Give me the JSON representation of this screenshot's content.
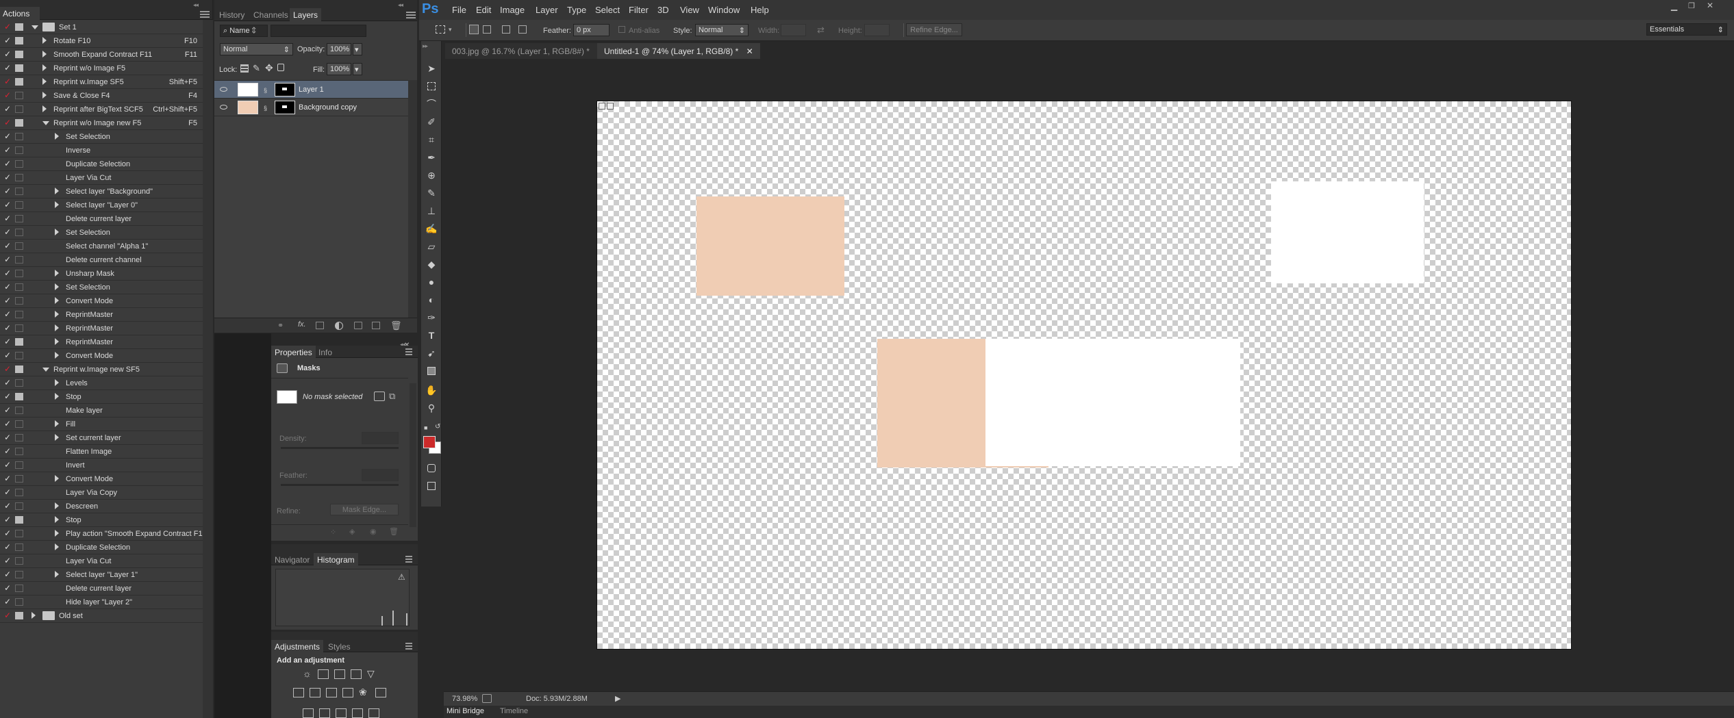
{
  "app": {
    "logo": "Ps"
  },
  "menu": [
    "File",
    "Edit",
    "Image",
    "Layer",
    "Type",
    "Select",
    "Filter",
    "3D",
    "View",
    "Window",
    "Help"
  ],
  "workspace": "Essentials",
  "options": {
    "feather_label": "Feather:",
    "feather_value": "0 px",
    "antialias_label": "Anti-alias",
    "style_label": "Style:",
    "style_value": "Normal",
    "width_label": "Width:",
    "height_label": "Height:",
    "refine_button": "Refine Edge..."
  },
  "doc_tabs": [
    {
      "label": "003.jpg @ 16.7% (Layer 1, RGB/8#) *",
      "selected": false
    },
    {
      "label": "Untitled-1 @ 74% (Layer 1, RGB/8) *",
      "selected": true
    }
  ],
  "actions": {
    "tab": "Actions",
    "rows": [
      {
        "label": "Set 1",
        "key": "",
        "check": true,
        "red": true,
        "dialog": "on",
        "level": 0,
        "kind": "folder",
        "open": true
      },
      {
        "label": "Rotate F10",
        "key": "F10",
        "check": true,
        "red": false,
        "dialog": "on",
        "level": 1,
        "kind": "action",
        "open": false
      },
      {
        "label": "Smooth Expand Contract F11",
        "key": "F11",
        "check": true,
        "red": false,
        "dialog": "on",
        "level": 1,
        "kind": "action",
        "open": false
      },
      {
        "label": "Reprint w/o Image F5",
        "key": "",
        "check": true,
        "red": false,
        "dialog": "on",
        "level": 1,
        "kind": "action",
        "open": false
      },
      {
        "label": "Reprint w.Image SF5",
        "key": "Shift+F5",
        "check": true,
        "red": true,
        "dialog": "on",
        "level": 1,
        "kind": "action",
        "open": false
      },
      {
        "label": "Save & Close F4",
        "key": "F4",
        "check": true,
        "red": true,
        "dialog": "off",
        "level": 1,
        "kind": "action",
        "open": false
      },
      {
        "label": "Reprint after BigText SCF5",
        "key": "Ctrl+Shift+F5",
        "check": true,
        "red": false,
        "dialog": "off",
        "level": 1,
        "kind": "action",
        "open": false
      },
      {
        "label": "Reprint w/o Image new F5",
        "key": "F5",
        "check": true,
        "red": true,
        "dialog": "on",
        "level": 1,
        "kind": "action",
        "open": true
      },
      {
        "label": "Set Selection",
        "key": "",
        "check": true,
        "red": false,
        "dialog": "off",
        "level": 2,
        "kind": "step",
        "open": false
      },
      {
        "label": "Inverse",
        "key": "",
        "check": true,
        "red": false,
        "dialog": "off",
        "level": 2,
        "kind": "leaf",
        "open": false
      },
      {
        "label": "Duplicate Selection",
        "key": "",
        "check": true,
        "red": false,
        "dialog": "off",
        "level": 2,
        "kind": "leaf",
        "open": false
      },
      {
        "label": "Layer Via Cut",
        "key": "",
        "check": true,
        "red": false,
        "dialog": "off",
        "level": 2,
        "kind": "leaf",
        "open": false
      },
      {
        "label": "Select layer \"Background\"",
        "key": "",
        "check": true,
        "red": false,
        "dialog": "off",
        "level": 2,
        "kind": "step",
        "open": false
      },
      {
        "label": "Select layer \"Layer 0\"",
        "key": "",
        "check": true,
        "red": false,
        "dialog": "off",
        "level": 2,
        "kind": "step",
        "open": false
      },
      {
        "label": "Delete current layer",
        "key": "",
        "check": true,
        "red": false,
        "dialog": "off",
        "level": 2,
        "kind": "leaf",
        "open": false
      },
      {
        "label": "Set Selection",
        "key": "",
        "check": true,
        "red": false,
        "dialog": "off",
        "level": 2,
        "kind": "step",
        "open": false
      },
      {
        "label": "Select channel \"Alpha 1\"",
        "key": "",
        "check": true,
        "red": false,
        "dialog": "off",
        "level": 2,
        "kind": "leaf",
        "open": false
      },
      {
        "label": "Delete current channel",
        "key": "",
        "check": true,
        "red": false,
        "dialog": "off",
        "level": 2,
        "kind": "leaf",
        "open": false
      },
      {
        "label": "Unsharp Mask",
        "key": "",
        "check": true,
        "red": false,
        "dialog": "off",
        "level": 2,
        "kind": "step",
        "open": false
      },
      {
        "label": "Set Selection",
        "key": "",
        "check": true,
        "red": false,
        "dialog": "off",
        "level": 2,
        "kind": "step",
        "open": false
      },
      {
        "label": "Convert Mode",
        "key": "",
        "check": true,
        "red": false,
        "dialog": "off",
        "level": 2,
        "kind": "step",
        "open": false
      },
      {
        "label": "ReprintMaster",
        "key": "",
        "check": true,
        "red": false,
        "dialog": "off",
        "level": 2,
        "kind": "step",
        "open": false
      },
      {
        "label": "ReprintMaster",
        "key": "",
        "check": true,
        "red": false,
        "dialog": "off",
        "level": 2,
        "kind": "step",
        "open": false
      },
      {
        "label": "ReprintMaster",
        "key": "",
        "check": true,
        "red": false,
        "dialog": "on",
        "level": 2,
        "kind": "step",
        "open": false
      },
      {
        "label": "Convert Mode",
        "key": "",
        "check": true,
        "red": false,
        "dialog": "off",
        "level": 2,
        "kind": "step",
        "open": false
      },
      {
        "label": "Reprint w.Image new SF5",
        "key": "",
        "check": true,
        "red": true,
        "dialog": "on",
        "level": 1,
        "kind": "action",
        "open": true
      },
      {
        "label": "Levels",
        "key": "",
        "check": true,
        "red": false,
        "dialog": "off",
        "level": 2,
        "kind": "step",
        "open": false
      },
      {
        "label": "Stop",
        "key": "",
        "check": true,
        "red": false,
        "dialog": "on",
        "level": 2,
        "kind": "step",
        "open": false
      },
      {
        "label": "Make layer",
        "key": "",
        "check": true,
        "red": false,
        "dialog": "off",
        "level": 2,
        "kind": "leaf",
        "open": false
      },
      {
        "label": "Fill",
        "key": "",
        "check": true,
        "red": false,
        "dialog": "off",
        "level": 2,
        "kind": "step",
        "open": false
      },
      {
        "label": "Set current layer",
        "key": "",
        "check": true,
        "red": false,
        "dialog": "off",
        "level": 2,
        "kind": "step",
        "open": false
      },
      {
        "label": "Flatten Image",
        "key": "",
        "check": true,
        "red": false,
        "dialog": "off",
        "level": 2,
        "kind": "leaf",
        "open": false
      },
      {
        "label": "Invert",
        "key": "",
        "check": true,
        "red": false,
        "dialog": "off",
        "level": 2,
        "kind": "leaf",
        "open": false
      },
      {
        "label": "Convert Mode",
        "key": "",
        "check": true,
        "red": false,
        "dialog": "off",
        "level": 2,
        "kind": "step",
        "open": false
      },
      {
        "label": "Layer Via Copy",
        "key": "",
        "check": true,
        "red": false,
        "dialog": "off",
        "level": 2,
        "kind": "leaf",
        "open": false
      },
      {
        "label": "Descreen",
        "key": "",
        "check": true,
        "red": false,
        "dialog": "off",
        "level": 2,
        "kind": "step",
        "open": false
      },
      {
        "label": "Stop",
        "key": "",
        "check": true,
        "red": false,
        "dialog": "on",
        "level": 2,
        "kind": "step",
        "open": false
      },
      {
        "label": "Play action \"Smooth Expand Contract F1...",
        "key": "",
        "check": true,
        "red": false,
        "dialog": "off",
        "level": 2,
        "kind": "step",
        "open": false
      },
      {
        "label": "Duplicate Selection",
        "key": "",
        "check": true,
        "red": false,
        "dialog": "off",
        "level": 2,
        "kind": "step",
        "open": false
      },
      {
        "label": "Layer Via Cut",
        "key": "",
        "check": true,
        "red": false,
        "dialog": "off",
        "level": 2,
        "kind": "leaf",
        "open": false
      },
      {
        "label": "Select layer \"Layer 1\"",
        "key": "",
        "check": true,
        "red": false,
        "dialog": "off",
        "level": 2,
        "kind": "step",
        "open": false
      },
      {
        "label": "Delete current layer",
        "key": "",
        "check": true,
        "red": false,
        "dialog": "off",
        "level": 2,
        "kind": "leaf",
        "open": false
      },
      {
        "label": "Hide layer \"Layer 2\"",
        "key": "",
        "check": true,
        "red": false,
        "dialog": "off",
        "level": 2,
        "kind": "leaf",
        "open": false
      },
      {
        "label": "Old set",
        "key": "",
        "check": true,
        "red": true,
        "dialog": "on",
        "level": 0,
        "kind": "folder",
        "open": false
      }
    ]
  },
  "layers_panel": {
    "tabs": [
      "History",
      "Channels",
      "Layers"
    ],
    "filter": "Name",
    "blend": "Normal",
    "opacity_label": "Opacity:",
    "opacity": "100%",
    "lock_label": "Lock:",
    "fill_label": "Fill:",
    "fill": "100%",
    "layers": [
      {
        "name": "Layer 1",
        "thumb": "#ffffff",
        "selected": true
      },
      {
        "name": "Background copy",
        "thumb": "#f0cdb4",
        "selected": false
      }
    ]
  },
  "properties": {
    "tabs": [
      "Properties",
      "Info"
    ],
    "section": "Masks",
    "no_mask": "No mask selected",
    "density_label": "Density:",
    "feather_label": "Feather:",
    "refine_label": "Refine:",
    "mask_edge_button": "Mask Edge..."
  },
  "navigator": {
    "tabs": [
      "Navigator",
      "Histogram"
    ]
  },
  "adjustments": {
    "tabs": [
      "Adjustments",
      "Styles"
    ],
    "heading": "Add an adjustment"
  },
  "status": {
    "zoom": "73.98%",
    "doc": "Doc: 5.93M/2.88M"
  },
  "bottom_tabs": [
    "Mini Bridge",
    "Timeline"
  ],
  "colors": {
    "foreground": "#cc2a2a",
    "background": "#ffffff",
    "skin": "#f0cdb4"
  }
}
